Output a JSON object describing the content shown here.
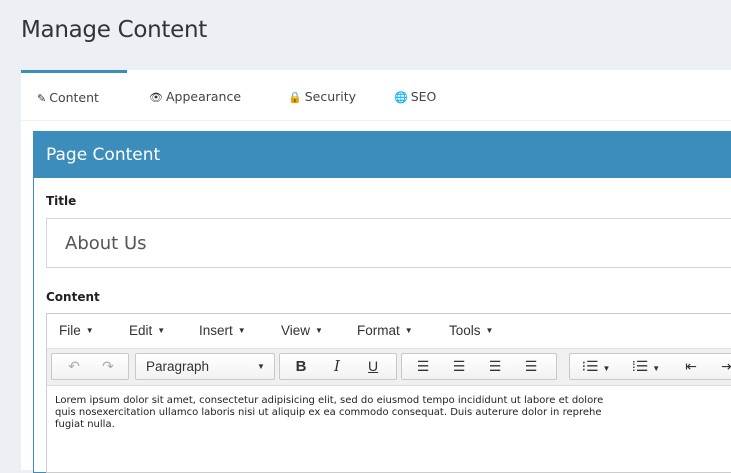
{
  "page": {
    "title": "Manage Content"
  },
  "tabs": [
    {
      "label": "Content",
      "icon": "pencil-icon"
    },
    {
      "label": "Appearance",
      "icon": "eye-icon"
    },
    {
      "label": "Security",
      "icon": "lock-icon"
    },
    {
      "label": "SEO",
      "icon": "globe-icon"
    }
  ],
  "panel": {
    "heading": "Page Content",
    "title_label": "Title",
    "title_value": "About Us",
    "content_label": "Content"
  },
  "editor": {
    "menus": [
      "File",
      "Edit",
      "Insert",
      "View",
      "Format",
      "Tools"
    ],
    "format_select": "Paragraph",
    "content_lines": [
      "Lorem ipsum dolor sit amet, consectetur adipisicing elit, sed do eiusmod tempo incididunt ut labore et dolore",
      "quis nosexercitation ullamco laboris nisi ut aliquip ex ea commodo consequat. Duis auterure dolor in reprehe",
      "fugiat nulla."
    ]
  },
  "colors": {
    "accent": "#3c8dbc",
    "background": "#ecf0f5"
  }
}
